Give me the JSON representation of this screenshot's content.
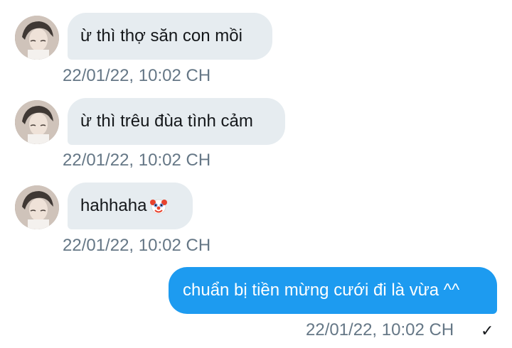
{
  "messages": [
    {
      "direction": "incoming",
      "avatar": "user-avatar",
      "text": "ừ thì thợ săn con mồi",
      "timestamp": "22/01/22, 10:02 CH"
    },
    {
      "direction": "incoming",
      "avatar": "user-avatar",
      "text": "ừ thì trêu đùa tình cảm",
      "timestamp": "22/01/22, 10:02 CH"
    },
    {
      "direction": "incoming",
      "avatar": "user-avatar",
      "text": "hahhaha",
      "emoji": "clown-face-emoji",
      "timestamp": "22/01/22, 10:02 CH"
    },
    {
      "direction": "outgoing",
      "text": "chuẩn bị tiền mừng cưới đi là vừa ^^",
      "timestamp": "22/01/22, 10:02 CH",
      "status_icon": "check-icon",
      "status_glyph": "✓"
    }
  ],
  "colors": {
    "incoming_bubble": "#e6ecf0",
    "outgoing_bubble": "#1d9bf0",
    "timestamp_text": "#657786",
    "message_text": "#14171a"
  }
}
